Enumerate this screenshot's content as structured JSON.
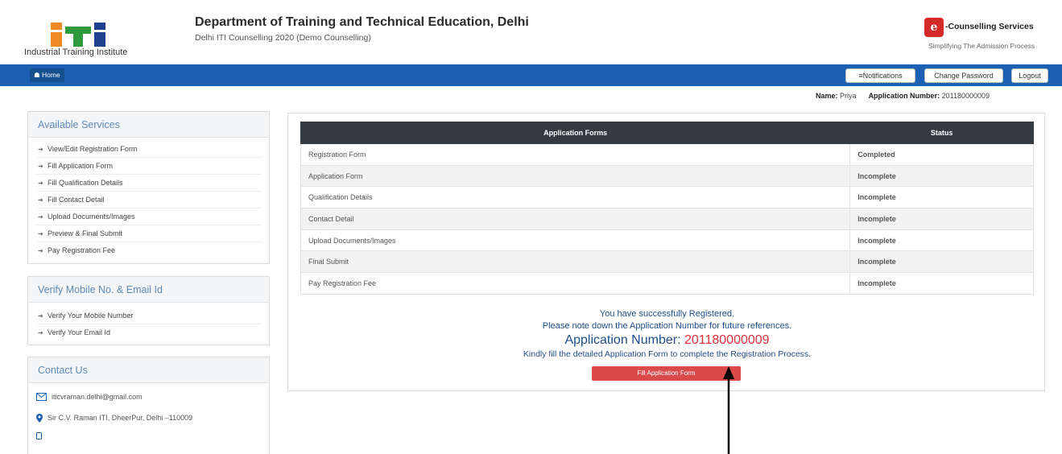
{
  "header": {
    "logo_caption": "Industrial Training Institute",
    "title": "Department of Training and Technical Education, Delhi",
    "subtitle": "Delhi ITI Counselling 2020 (Demo Counselling)",
    "brand_name": "-Counselling Services",
    "brand_tagline": "Simplifying The Admission Process"
  },
  "nav": {
    "home": "Home",
    "notifications": "Notifications",
    "change_password": "Change Password",
    "logout": "Logout"
  },
  "user": {
    "name_label": "Name:",
    "name": "Priya",
    "app_number_label": "Application Number:",
    "app_number": "201180000009"
  },
  "sidebar": {
    "services_title": "Available Services",
    "services": [
      "View/Edit Registration Form",
      "Fill Application Form",
      "Fill Qualification Details",
      "Fill Contact Detail",
      "Upload Documents/Images",
      "Preview & Final Submit",
      "Pay Registration Fee"
    ],
    "verify_title": "Verify Mobile No. & Email Id",
    "verify_items": [
      "Verify Your Mobile Number",
      "Verify Your Email Id"
    ],
    "contact_title": "Contact Us",
    "contact_email": "iticvraman.delhi@gmail.com",
    "contact_address": "Sir C.V. Raman ITI, DheerPur, Delhi –110009"
  },
  "table": {
    "col_forms": "Application Forms",
    "col_status": "Status",
    "rows": [
      {
        "form": "Registration Form",
        "status": "Completed"
      },
      {
        "form": "Application Form",
        "status": "Incomplete"
      },
      {
        "form": "Qualification Details",
        "status": "Incomplete"
      },
      {
        "form": "Contact Detail",
        "status": "Incomplete"
      },
      {
        "form": "Upload Documents/Images",
        "status": "Incomplete"
      },
      {
        "form": "Final Submit",
        "status": "Incomplete"
      },
      {
        "form": "Pay Registration Fee",
        "status": "Incomplete"
      }
    ]
  },
  "message": {
    "line1": "You have successfully Registered.",
    "line2": "Please note down the Application Number for future references.",
    "appnum_label": "Application Number:",
    "appnum_value": "201180000009",
    "line3": "Kindly fill the detailed Application Form to complete the Registration Process.",
    "button": "Fill Application Form"
  },
  "colors": {
    "nav_blue": "#1b60b3",
    "status_complete": "#2a8a2a",
    "status_incomplete": "#d9303a",
    "table_header": "#343a40",
    "button_red": "#d94b4b"
  }
}
